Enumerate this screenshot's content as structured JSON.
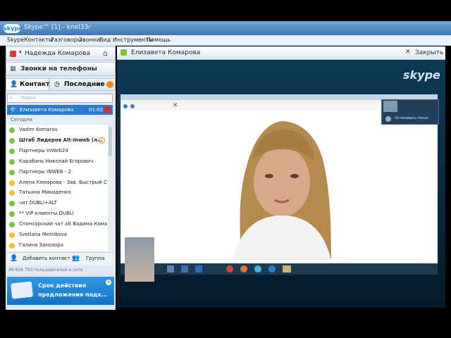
{
  "window": {
    "app_badge": "skype",
    "title": "Skype™ [1] - knel33r"
  },
  "menu": [
    "Skype",
    "Контакты",
    "Разговоры",
    "Звонки",
    "Вид",
    "Инструменты",
    "Помощь"
  ],
  "profile": {
    "name": "Надежда Комарова"
  },
  "call_phones_label": "Звонки на телефоны",
  "tabs": {
    "contacts": "Контакты",
    "recent": "Последние"
  },
  "search": {
    "placeholder": "Поиск"
  },
  "active_call": {
    "name": "Елизавета Комарова",
    "duration": "01:02"
  },
  "section_label": "Сегодня",
  "contacts": [
    {
      "name": "Vadim Komarov",
      "color": "#7fc241",
      "bold": false,
      "badge": ""
    },
    {
      "name": "Штаб Лидеров Alt-Inweb (л...",
      "color": "#7fc241",
      "bold": true,
      "badge": "!"
    },
    {
      "name": "Партнеры InWeb24",
      "color": "#7fc241",
      "bold": false,
      "badge": ""
    },
    {
      "name": "Карабань Николай Егорович",
      "color": "#7fc241",
      "bold": false,
      "badge": ""
    },
    {
      "name": "Партнеры INWEB - 2",
      "color": "#7fc241",
      "bold": false,
      "badge": ""
    },
    {
      "name": "Алена Комарова - Зав. Быстрый Ста...",
      "color": "#f3c12a",
      "bold": false,
      "badge": ""
    },
    {
      "name": "Татьяна Микиденко",
      "color": "#f3c12a",
      "bold": false,
      "badge": ""
    },
    {
      "name": "чат DUBLI+ALT",
      "color": "#7fc241",
      "bold": false,
      "badge": ""
    },
    {
      "name": "** VIP клиенты DUBLI",
      "color": "#7fc241",
      "bold": false,
      "badge": ""
    },
    {
      "name": "Спонсорский чат alt Вадима Комаро...",
      "color": "#7fc241",
      "bold": false,
      "badge": ""
    },
    {
      "name": "Svetlana Melnikova",
      "color": "#f3c12a",
      "bold": false,
      "badge": ""
    },
    {
      "name": "Галина Занозора",
      "color": "#f3c12a",
      "bold": false,
      "badge": ""
    }
  ],
  "buttons": {
    "add_contact": "Добавить контакт",
    "group": "Группа"
  },
  "users_online": "48 804 793 пользователей в сети",
  "promo": {
    "line1": "Срок действия",
    "line2": "предложения подх..."
  },
  "conversation": {
    "name": "Елизавета Комарова",
    "close_label": "Закрыть"
  },
  "self_view": {
    "stop_label": "Остановить показ"
  },
  "brand_watermark": "skype"
}
